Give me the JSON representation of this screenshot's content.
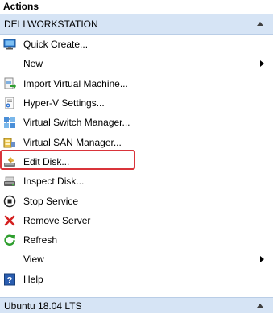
{
  "pane": {
    "title": "Actions"
  },
  "section": {
    "name": "DELLWORKSTATION"
  },
  "items": [
    {
      "label": "Quick Create...",
      "icon": "monitor-icon"
    },
    {
      "label": "New",
      "icon": "none",
      "submenu": true
    },
    {
      "label": "Import Virtual Machine...",
      "icon": "import-vm-icon"
    },
    {
      "label": "Hyper-V Settings...",
      "icon": "settings-doc-icon"
    },
    {
      "label": "Virtual Switch Manager...",
      "icon": "virtual-switch-icon",
      "highlighted": true
    },
    {
      "label": "Virtual SAN Manager...",
      "icon": "virtual-san-icon"
    },
    {
      "label": "Edit Disk...",
      "icon": "edit-disk-icon"
    },
    {
      "label": "Inspect Disk...",
      "icon": "inspect-disk-icon"
    },
    {
      "label": "Stop Service",
      "icon": "stop-icon"
    },
    {
      "label": "Remove Server",
      "icon": "remove-x-icon"
    },
    {
      "label": "Refresh",
      "icon": "refresh-icon"
    },
    {
      "label": "View",
      "icon": "none",
      "submenu": true
    },
    {
      "label": "Help",
      "icon": "help-icon"
    }
  ],
  "next_section": {
    "name": "Ubuntu 18.04 LTS"
  },
  "colors": {
    "section_header_bg": "#d6e4f5",
    "highlight_border": "#d9343a",
    "remove_red": "#d42020",
    "refresh_green": "#2e9e2e",
    "help_blue": "#2a5db0"
  }
}
